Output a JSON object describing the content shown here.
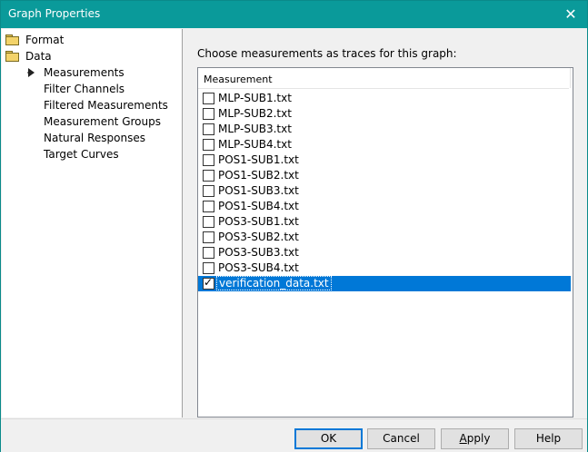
{
  "window": {
    "title": "Graph Properties",
    "close_symbol": "✕"
  },
  "tree": {
    "items": [
      {
        "label": "Format",
        "icon": "folder-icon",
        "level": 0
      },
      {
        "label": "Data",
        "icon": "folder-icon",
        "level": 0
      },
      {
        "label": "Measurements",
        "icon": "arrow-icon",
        "level": 1,
        "current": true
      },
      {
        "label": "Filter Channels",
        "level": 1
      },
      {
        "label": "Filtered Measurements",
        "level": 1
      },
      {
        "label": "Measurement Groups",
        "level": 1
      },
      {
        "label": "Natural Responses",
        "level": 1
      },
      {
        "label": "Target Curves",
        "level": 1
      }
    ]
  },
  "main": {
    "prompt": "Choose measurements as traces for this graph:",
    "list": {
      "column_header": "Measurement",
      "items": [
        {
          "label": "MLP-SUB1.txt",
          "checked": false,
          "selected": false
        },
        {
          "label": "MLP-SUB2.txt",
          "checked": false,
          "selected": false
        },
        {
          "label": "MLP-SUB3.txt",
          "checked": false,
          "selected": false
        },
        {
          "label": "MLP-SUB4.txt",
          "checked": false,
          "selected": false
        },
        {
          "label": "POS1-SUB1.txt",
          "checked": false,
          "selected": false
        },
        {
          "label": "POS1-SUB2.txt",
          "checked": false,
          "selected": false
        },
        {
          "label": "POS1-SUB3.txt",
          "checked": false,
          "selected": false
        },
        {
          "label": "POS1-SUB4.txt",
          "checked": false,
          "selected": false
        },
        {
          "label": "POS3-SUB1.txt",
          "checked": false,
          "selected": false
        },
        {
          "label": "POS3-SUB2.txt",
          "checked": false,
          "selected": false
        },
        {
          "label": "POS3-SUB3.txt",
          "checked": false,
          "selected": false
        },
        {
          "label": "POS3-SUB4.txt",
          "checked": false,
          "selected": false
        },
        {
          "label": "verification_data.txt",
          "checked": true,
          "selected": true
        }
      ]
    }
  },
  "buttons": {
    "ok": "OK",
    "cancel": "Cancel",
    "apply_prefix": "",
    "apply_mnemonic": "A",
    "apply_suffix": "pply",
    "help": "Help"
  },
  "colors": {
    "titlebar": "#0a9a9a",
    "selection": "#0078d7"
  }
}
